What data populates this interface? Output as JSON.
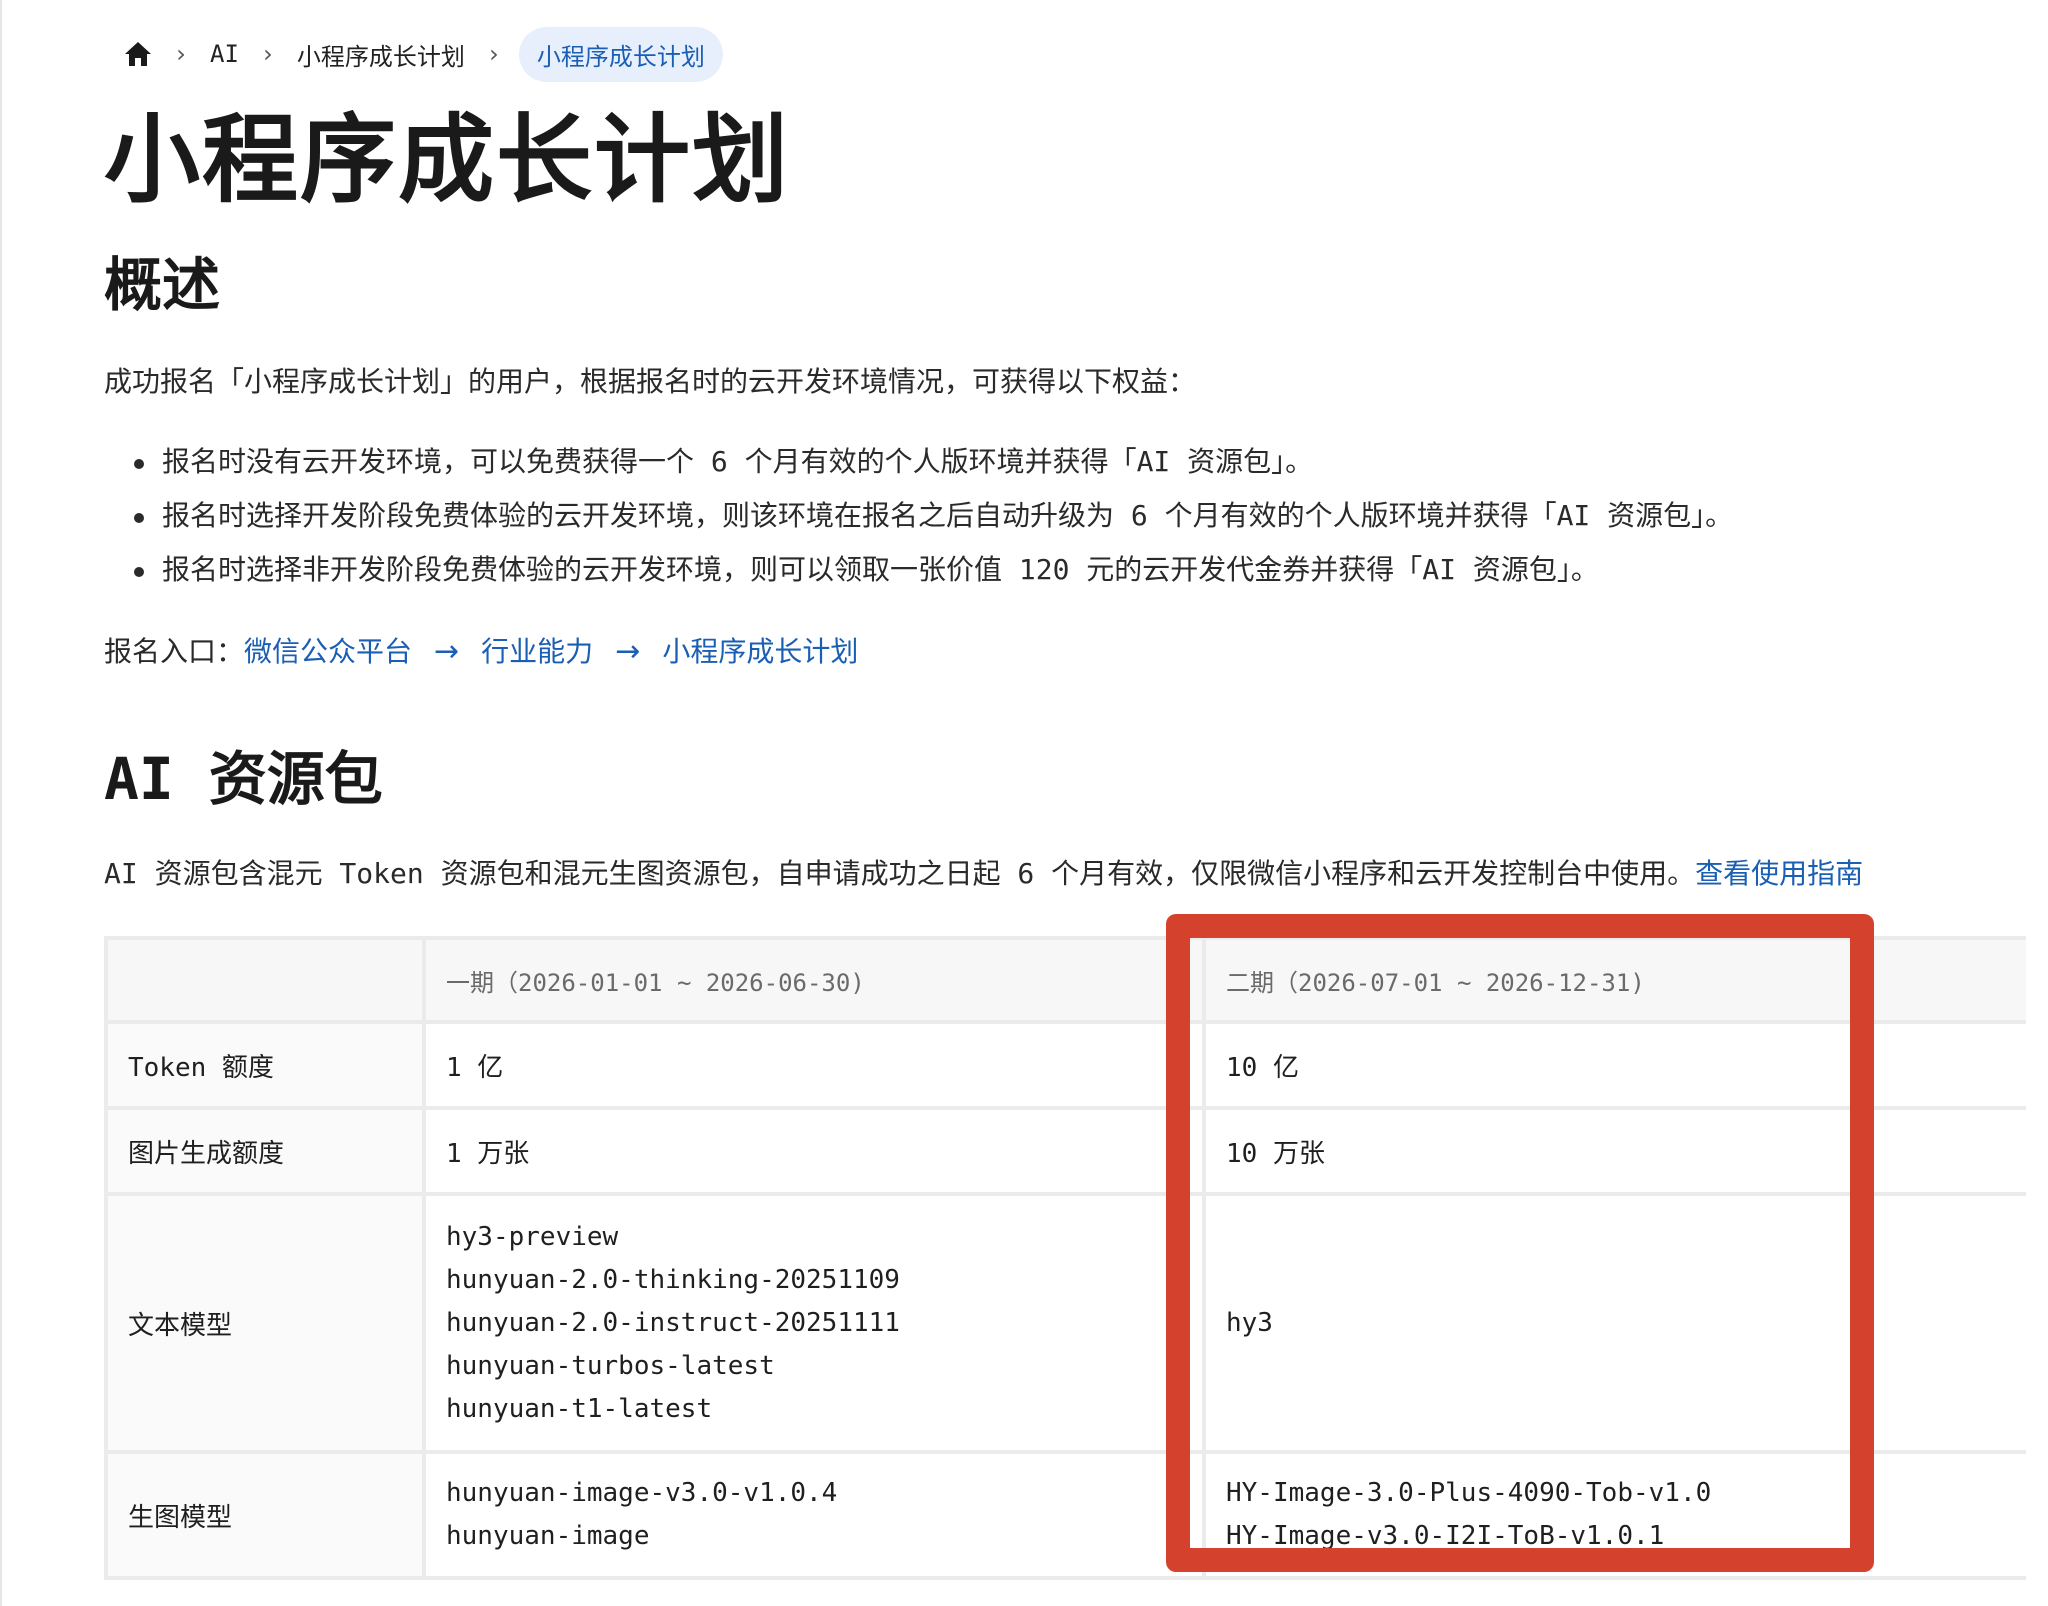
{
  "breadcrumb": {
    "items": [
      "AI",
      "小程序成长计划"
    ],
    "current": "小程序成长计划"
  },
  "page_title": "小程序成长计划",
  "overview": {
    "heading": "概述",
    "intro": "成功报名「小程序成长计划」的用户，根据报名时的云开发环境情况，可获得以下权益：",
    "benefits": [
      "报名时没有云开发环境，可以免费获得一个 6 个月有效的个人版环境并获得「AI 资源包」。",
      "报名时选择开发阶段免费体验的云开发环境，则该环境在报名之后自动升级为 6 个月有效的个人版环境并获得「AI 资源包」。",
      "报名时选择非开发阶段免费体验的云开发环境，则可以领取一张价值 120 元的云开发代金券并获得「AI 资源包」。"
    ],
    "entry_label": "报名入口：",
    "entry_links": [
      "微信公众平台",
      "行业能力",
      "小程序成长计划"
    ],
    "arrow": "→"
  },
  "ai_pack": {
    "heading": "AI 资源包",
    "description": "AI 资源包含混元 Token 资源包和混元生图资源包，自申请成功之日起 6 个月有效，仅限微信小程序和云开发控制台中使用。",
    "guide_link": "查看使用指南"
  },
  "table": {
    "headers": [
      "",
      "一期（2026-01-01 ~ 2026-06-30)",
      "二期（2026-07-01 ~ 2026-12-31)"
    ],
    "rows": [
      {
        "label": "Token 额度",
        "phase1": "1 亿",
        "phase2": "10 亿"
      },
      {
        "label": "图片生成额度",
        "phase1": "1 万张",
        "phase2": "10 万张"
      },
      {
        "label": "文本模型",
        "phase1": [
          "hy3-preview",
          "hunyuan-2.0-thinking-20251109",
          "hunyuan-2.0-instruct-20251111",
          "hunyuan-turbos-latest",
          "hunyuan-t1-latest"
        ],
        "phase2": [
          "hy3"
        ]
      },
      {
        "label": "生图模型",
        "phase1": [
          "hunyuan-image-v3.0-v1.0.4",
          "hunyuan-image"
        ],
        "phase2": [
          "HY-Image-3.0-Plus-4090-Tob-v1.0",
          "HY-Image-v3.0-I2I-ToB-v1.0.1"
        ]
      }
    ]
  },
  "colors": {
    "link": "#1a5fb4",
    "highlight_box": "#d4412c",
    "breadcrumb_active_bg": "#e8effc"
  },
  "icons": {
    "home": "home-icon",
    "separator": "chevron-right-icon",
    "arrow": "arrow-right-icon"
  }
}
